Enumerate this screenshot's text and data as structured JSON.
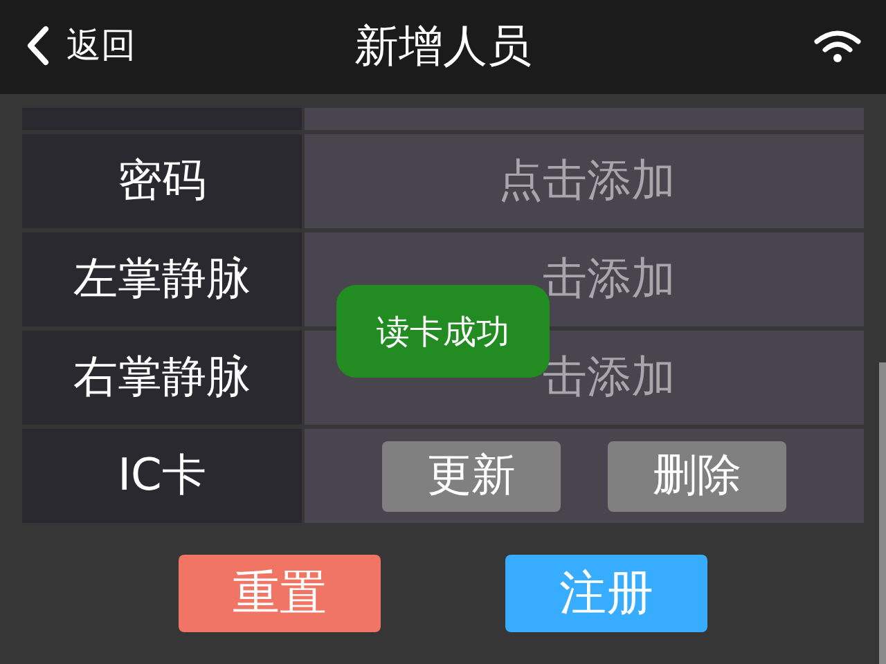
{
  "header": {
    "back_label": "返回",
    "title": "新增人员"
  },
  "rows": [
    {
      "label": "密码",
      "kind": "add",
      "placeholder": "点击添加"
    },
    {
      "label": "左掌静脉",
      "kind": "add",
      "placeholder": "击添加"
    },
    {
      "label": "右掌静脉",
      "kind": "add",
      "placeholder": "击添加"
    },
    {
      "label": "IC卡",
      "kind": "buttons",
      "buttons": [
        "更新",
        "删除"
      ]
    }
  ],
  "actions": [
    {
      "label": "重置",
      "color": "#f07565"
    },
    {
      "label": "注册",
      "color": "#38acff"
    }
  ],
  "toast": "读卡成功"
}
